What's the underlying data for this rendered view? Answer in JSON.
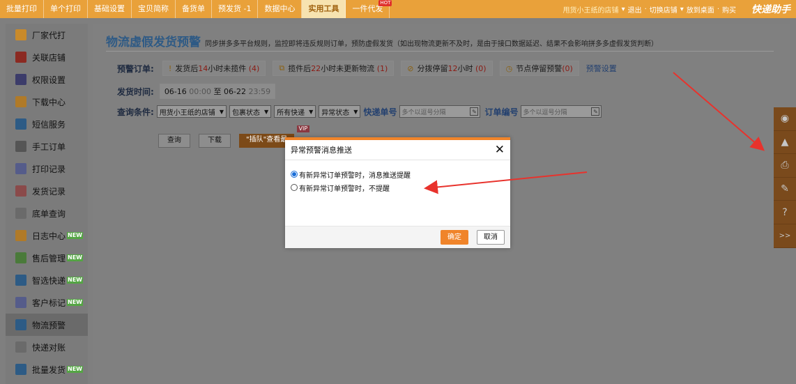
{
  "topnav": {
    "items": [
      "批量打印",
      "单个打印",
      "基础设置",
      "宝贝简称",
      "备货单",
      "预发货 -1",
      "数据中心",
      "实用工具",
      "一件代发"
    ],
    "active_index": 7,
    "hot_badge": "HOT",
    "shop_name": "甩货小王纸的店铺",
    "links": [
      "退出",
      "切换店铺",
      "放到桌面",
      "购买"
    ],
    "logo": "快递助手"
  },
  "sidebar": {
    "items": [
      {
        "label": "厂家代打",
        "new": false,
        "color": "#c98a2a"
      },
      {
        "label": "关联店铺",
        "new": false,
        "color": "#8b2a22"
      },
      {
        "label": "权限设置",
        "new": false,
        "color": "#3c3c6a"
      },
      {
        "label": "下载中心",
        "new": false,
        "color": "#b07a28"
      },
      {
        "label": "短信服务",
        "new": false,
        "color": "#2d5b85"
      },
      {
        "label": "手工订单",
        "new": false,
        "color": "#555555"
      },
      {
        "label": "打印记录",
        "new": false,
        "color": "#555c8a"
      },
      {
        "label": "发货记录",
        "new": false,
        "color": "#8a4a4a"
      },
      {
        "label": "底单查询",
        "new": false,
        "color": "#6a6a6a"
      },
      {
        "label": "日志中心",
        "new": true,
        "color": "#b07a28"
      },
      {
        "label": "售后管理",
        "new": true,
        "color": "#4a7a3a"
      },
      {
        "label": "智选快递",
        "new": true,
        "color": "#2d5b85"
      },
      {
        "label": "客户标记",
        "new": true,
        "color": "#555c8a"
      },
      {
        "label": "物流预警",
        "new": false,
        "color": "#2d5b85"
      },
      {
        "label": "快递对账",
        "new": false,
        "color": "#6a6a6a"
      },
      {
        "label": "批量发货",
        "new": true,
        "color": "#2d5b85"
      }
    ],
    "active_index": 13,
    "new_badge": "NEW"
  },
  "main": {
    "title": "物流虚假发货预警",
    "desc": "同步拼多多平台规则，监控即将违反规则订单，预防虚假发货（如出现物流更新不及时，是由于接口数据延迟、结果不会影响拼多多虚假发货判断）",
    "alert_label": "预警订单:",
    "alerts": [
      {
        "pre": "发货后",
        "num": "14",
        "post": "小时未揽件",
        "count": "(4)"
      },
      {
        "pre": "揽件后",
        "num": "22",
        "post": "小时未更新物流",
        "count": "(1)"
      },
      {
        "pre": "分拨停留",
        "num": "12",
        "post": "小时",
        "count": "(0)"
      },
      {
        "pre": "节点停留预警",
        "num": "",
        "post": "",
        "count": "(0)"
      }
    ],
    "alert_settings": "预警设置",
    "time_label": "发货时间:",
    "date_from": "06-16",
    "time_from": "00:00",
    "date_sep": "至",
    "date_to": "06-22",
    "time_to": "23:59",
    "query_label": "查询条件:",
    "selects": [
      "甩货小王纸的店铺",
      "包裹状态",
      "所有快递",
      "异常状态"
    ],
    "tracking_label": "快递单号",
    "tracking_placeholder": "多个以逗号分隔",
    "order_label": "订单编号",
    "order_placeholder": "多个以逗号分隔",
    "btn_query": "查询",
    "btn_download": "下载",
    "btn_jump": "\"插队\"查看最",
    "vip": "VIP"
  },
  "dialog": {
    "title": "异常预警消息推送",
    "close": "✕",
    "options": [
      "有新异常订单预警时，消息推送提醒",
      "有新异常订单预警时，不提醒"
    ],
    "selected_index": 0,
    "ok": "确定",
    "cancel": "取消"
  },
  "rightbar": {
    "icons": [
      "qq-icon",
      "warning-icon",
      "printer-icon",
      "edit-icon",
      "help-icon",
      "expand-icon"
    ],
    "more": ">>"
  },
  "colors": {
    "accent": "#f0842a",
    "topbar": "#e9a13a",
    "selected_radio": "#1a6ed8",
    "arrow": "#e8322c"
  }
}
